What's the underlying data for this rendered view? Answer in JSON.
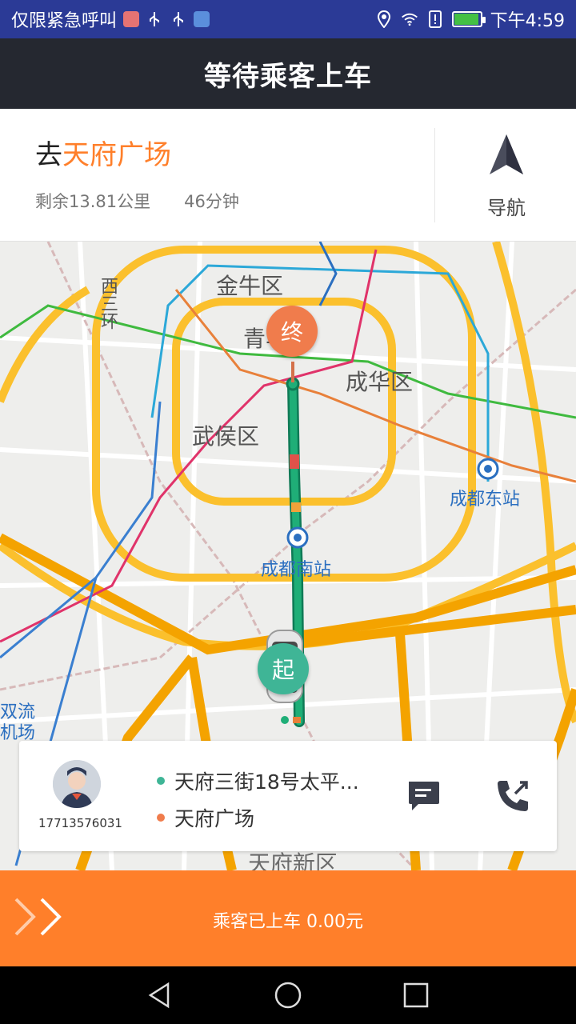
{
  "status_bar": {
    "carrier_text": "仅限紧急呼叫",
    "time": "下午4:59"
  },
  "header": {
    "title": "等待乘客上车"
  },
  "destination": {
    "prefix": "去",
    "place": "天府广场",
    "distance_remaining": "剩余13.81公里",
    "time_remaining": "46分钟",
    "nav_label": "导航"
  },
  "map": {
    "labels": {
      "jinniu": "金牛区",
      "qingyang": "青羊区",
      "chenghua": "成华区",
      "wuhou": "武侯区",
      "west_ring": "西三环",
      "chengdu_east": "成都东站",
      "chengdu_south": "成都南站",
      "shuangliu_1": "双流",
      "shuangliu_2": "机场",
      "tianfu_new": "天府新区"
    },
    "markers": {
      "end": "终",
      "start": "起"
    }
  },
  "passenger": {
    "phone": "17713576031",
    "origin": "天府三街18号太平...",
    "destination": "天府广场"
  },
  "action": {
    "label": "乘客已上车 0.00元"
  },
  "colors": {
    "accent": "#ff7f2a",
    "header_bg": "#252830",
    "status_bg": "#2b3a96",
    "start_marker": "#3fb596",
    "end_marker": "#f07c4c"
  }
}
